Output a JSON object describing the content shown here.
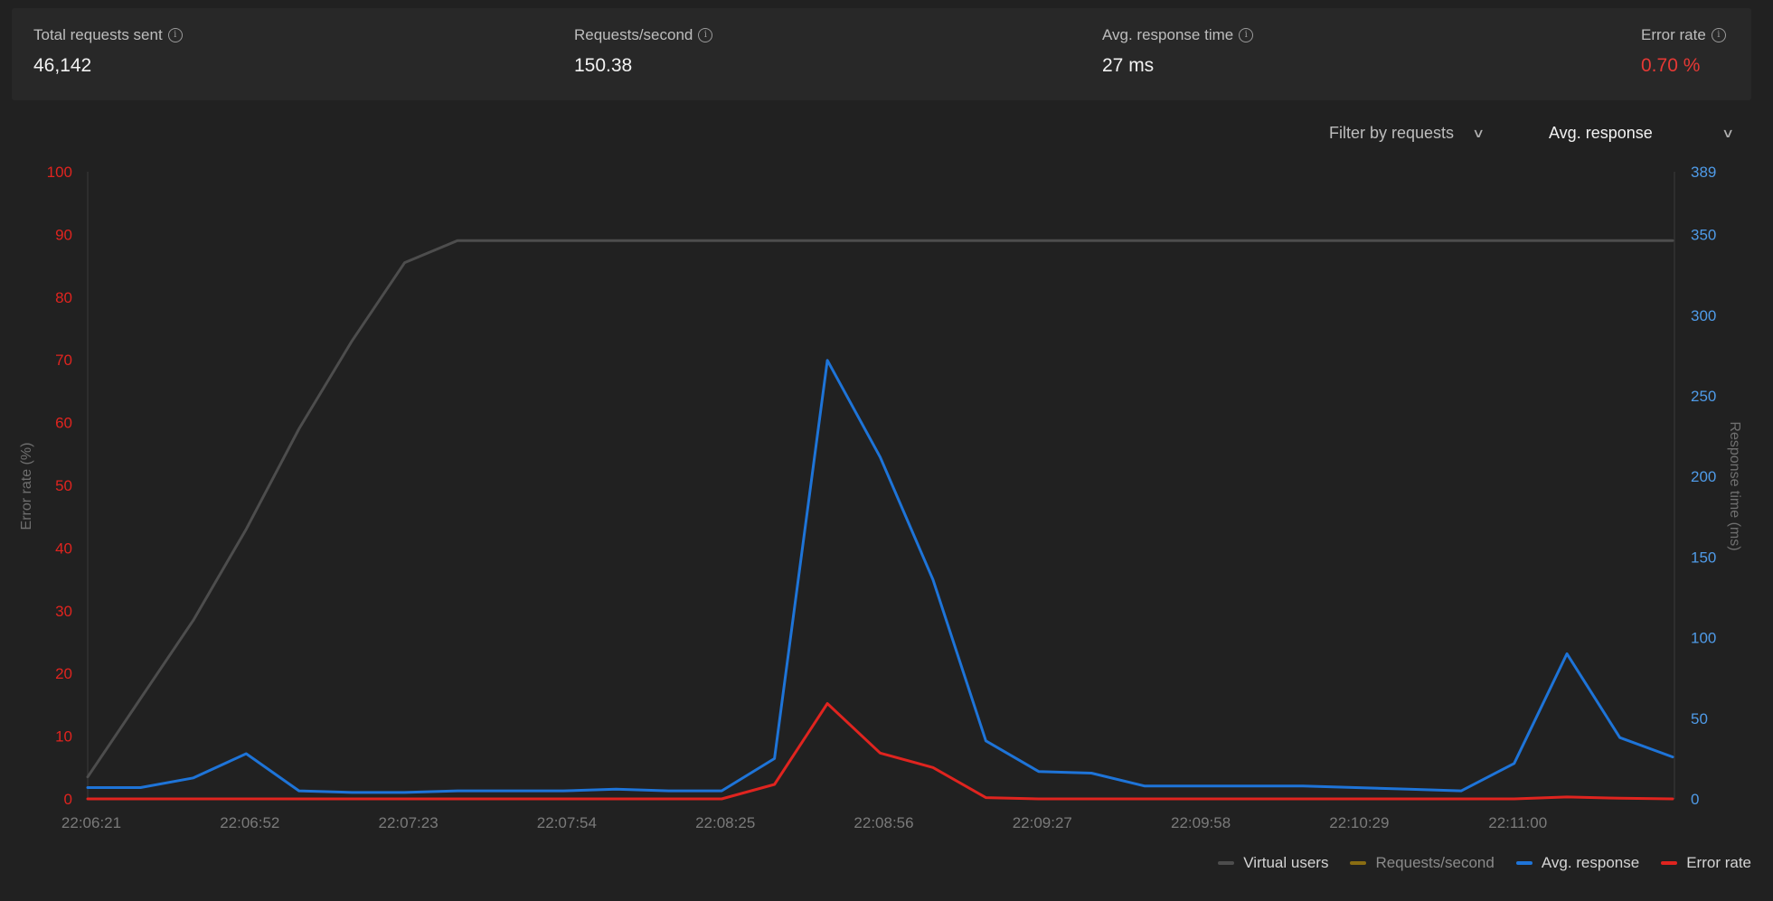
{
  "stats": [
    {
      "label": "Total requests sent",
      "value": "46,142",
      "value_color": "#f2f2f2"
    },
    {
      "label": "Requests/second",
      "value": "150.38",
      "value_color": "#f2f2f2"
    },
    {
      "label": "Avg. response time",
      "value": "27 ms",
      "value_color": "#f2f2f2"
    },
    {
      "label": "Error rate",
      "value": "0.70 %",
      "value_color": "#e53935"
    }
  ],
  "filters": {
    "requests_label": "Filter by requests",
    "metric_label": "Avg. response"
  },
  "legend": [
    {
      "label": "Virtual users",
      "color": "#4d4d4d",
      "label_color": "#d4d4d4"
    },
    {
      "label": "Requests/second",
      "color": "#8a6d12",
      "label_color": "#8a8a8a"
    },
    {
      "label": "Avg. response",
      "color": "#1e74d8",
      "label_color": "#d4d4d4"
    },
    {
      "label": "Error rate",
      "color": "#e0241f",
      "label_color": "#d4d4d4"
    }
  ],
  "chart_data": {
    "type": "line",
    "x_ticks": [
      "22:06:21",
      "22:06:52",
      "22:07:23",
      "22:07:54",
      "22:08:25",
      "22:08:56",
      "22:09:27",
      "22:09:58",
      "22:10:29",
      "22:11:00"
    ],
    "x": [
      "22:06:21",
      "22:06:31",
      "22:06:41",
      "22:06:52",
      "22:07:02",
      "22:07:12",
      "22:07:23",
      "22:07:33",
      "22:07:43",
      "22:07:54",
      "22:08:04",
      "22:08:14",
      "22:08:25",
      "22:08:35",
      "22:08:45",
      "22:08:56",
      "22:09:06",
      "22:09:16",
      "22:09:27",
      "22:09:37",
      "22:09:47",
      "22:09:58",
      "22:10:08",
      "22:10:18",
      "22:10:29",
      "22:10:39",
      "22:10:49",
      "22:11:00",
      "22:11:10",
      "22:11:20",
      "22:11:31"
    ],
    "y_left": {
      "label": "Error rate (%)",
      "ticks": [
        0,
        10,
        20,
        30,
        40,
        50,
        60,
        70,
        80,
        90,
        100
      ],
      "range": [
        0,
        100
      ],
      "color": "#e0241f"
    },
    "y_right": {
      "label": "Response time (ms)",
      "ticks": [
        0,
        50,
        100,
        150,
        200,
        250,
        300,
        350,
        389
      ],
      "range": [
        0,
        389
      ],
      "color": "#4f9be8"
    },
    "series": [
      {
        "name": "Virtual users",
        "axis": "left",
        "color": "#4d4d4d",
        "values": [
          3.5,
          16,
          28.5,
          43,
          59,
          73,
          85.5,
          89,
          89,
          89,
          89,
          89,
          89,
          89,
          89,
          89,
          89,
          89,
          89,
          89,
          89,
          89,
          89,
          89,
          89,
          89,
          89,
          89,
          89,
          89,
          89
        ]
      },
      {
        "name": "Avg. response",
        "axis": "right",
        "color": "#1e74d8",
        "values": [
          7,
          7,
          13,
          28,
          5,
          4,
          4,
          5,
          5,
          5,
          6,
          5,
          5,
          25,
          272,
          212,
          136,
          36,
          17,
          16,
          8,
          8,
          8,
          8,
          7,
          6,
          5,
          22,
          90,
          38,
          26
        ]
      },
      {
        "name": "Error rate",
        "axis": "left",
        "color": "#e0241f",
        "values": [
          0,
          0,
          0,
          0,
          0,
          0,
          0,
          0,
          0,
          0,
          0,
          0,
          0,
          2.3,
          15.2,
          7.3,
          5,
          0.2,
          0,
          0,
          0,
          0,
          0,
          0,
          0,
          0,
          0,
          0,
          0.3,
          0.1,
          0
        ]
      }
    ],
    "grid": false,
    "legend_position": "bottom-right"
  }
}
